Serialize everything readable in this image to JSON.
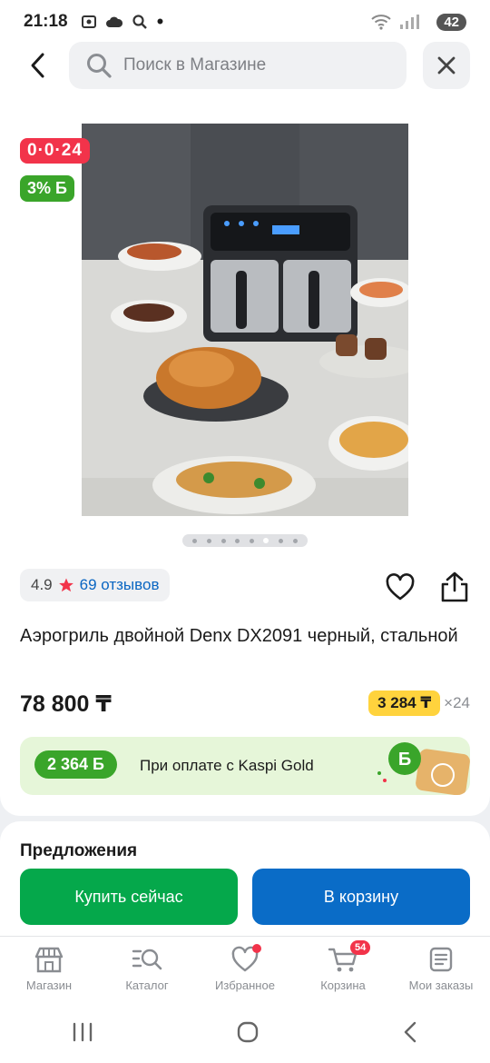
{
  "status": {
    "time": "21:18",
    "battery": "42"
  },
  "search": {
    "placeholder": "Поиск в Магазине"
  },
  "badges": {
    "timer": "0·0·24",
    "bonus_percent": "3% Б"
  },
  "gallery": {
    "total": 8,
    "active_index": 5
  },
  "rating": {
    "value": "4.9",
    "reviews": "69 отзывов"
  },
  "product": {
    "title": "Аэрогриль двойной Denx DX2091 черный, стальной",
    "price": "78 800 ₸",
    "installment_amount": "3 284 ₸",
    "installment_months": "×24"
  },
  "kaspi": {
    "bonus": "2 364 Б",
    "text": "При оплате с Kaspi Gold"
  },
  "offers": {
    "title": "Предложения"
  },
  "actions": {
    "buy": "Купить сейчас",
    "cart": "В корзину"
  },
  "nav": {
    "items": [
      {
        "label": "Магазин",
        "icon": "shop-icon"
      },
      {
        "label": "Каталог",
        "icon": "catalog-search-icon"
      },
      {
        "label": "Избранное",
        "icon": "heart-icon"
      },
      {
        "label": "Корзина",
        "icon": "cart-icon",
        "badge": "54"
      },
      {
        "label": "Мои заказы",
        "icon": "orders-icon"
      }
    ]
  },
  "colors": {
    "accent_green": "#05a84b",
    "accent_blue": "#0a6cc7",
    "badge_red": "#f2334a",
    "installment_yellow": "#ffd33d"
  }
}
